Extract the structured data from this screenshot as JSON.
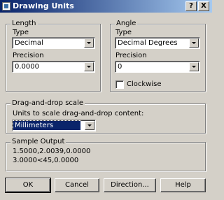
{
  "window": {
    "title": "Drawing Units",
    "help_button": "?",
    "close_button": "X"
  },
  "length": {
    "group_label": "Length",
    "type_label": "Type",
    "type_value": "Decimal",
    "precision_label": "Precision",
    "precision_value": "0.0000"
  },
  "angle": {
    "group_label": "Angle",
    "type_label": "Type",
    "type_value": "Decimal Degrees",
    "precision_label": "Precision",
    "precision_value": "0",
    "clockwise_label": "Clockwise",
    "clockwise_checked": false
  },
  "dragdrop": {
    "group_label": "Drag-and-drop scale",
    "units_label": "Units to scale drag-and-drop content:",
    "units_value": "Millimeters"
  },
  "sample": {
    "group_label": "Sample Output",
    "line1": "1.5000,2.0039,0.0000",
    "line2": "3.0000<45,0.0000"
  },
  "buttons": {
    "ok": "OK",
    "cancel": "Cancel",
    "direction": "Direction...",
    "help": "Help"
  }
}
